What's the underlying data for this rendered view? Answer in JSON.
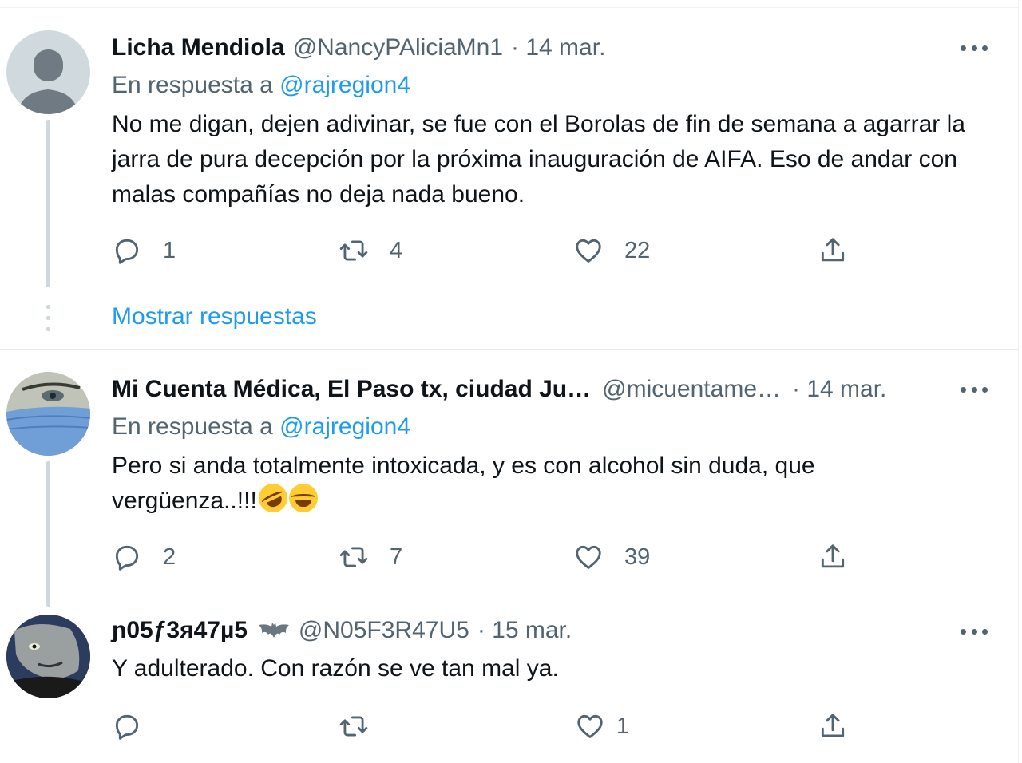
{
  "tweets": [
    {
      "name": "Licha Mendiola",
      "handle": "@NancyPAliciaMn1",
      "meta": "· 14 mar.",
      "reply_prefix": "En respuesta a",
      "reply_handle": "@rajregion4",
      "text": "No me digan, dejen adivinar, se fue con el Borolas de fin de semana a agarrar la jarra de pura decepción por la próxima inauguración de AIFA. Eso de andar con malas compañías no deja nada bueno.",
      "replies": "1",
      "retweets": "4",
      "likes": "22",
      "show_replies": "Mostrar respuestas"
    },
    {
      "name": "Mi Cuenta Médica, El Paso tx, ciudad Ju…",
      "handle": "@micuentame…",
      "meta": "· 14 mar.",
      "reply_prefix": "En respuesta a",
      "reply_handle": "@rajregion4",
      "text_line1": "Pero si anda totalmente intoxicada, y es con alcohol sin duda, que",
      "text_line2": "vergüenza..!!!",
      "emojis": [
        "rolling-on-floor-laughing-emoji",
        "tears-of-joy-emoji"
      ],
      "replies": "2",
      "retweets": "7",
      "likes": "39"
    },
    {
      "name": "ɲ05ƒ3я47µ5",
      "handle": "@N05F3R47U5",
      "meta": "· 15 mar.",
      "text": "Y adulterado. Con razón se ve tan mal ya.",
      "replies": "",
      "retweets": "",
      "likes": "1"
    }
  ],
  "colors": {
    "link": "#1d9bf0",
    "secondary": "#536471",
    "text": "#0f1419",
    "thread": "#cfd9de"
  },
  "icons": [
    "reply-icon",
    "retweet-icon",
    "like-icon",
    "share-icon",
    "more-icon",
    "bat-icon"
  ]
}
